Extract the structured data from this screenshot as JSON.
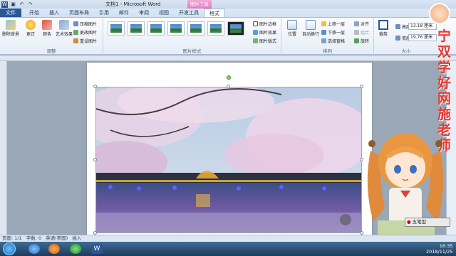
{
  "window": {
    "title": "文档1 - Microsoft Word",
    "context_tool": "图片工具"
  },
  "tabs": [
    "文件",
    "开始",
    "插入",
    "页面布局",
    "引用",
    "邮件",
    "审阅",
    "视图",
    "开发工具",
    "格式"
  ],
  "ribbon": {
    "adjust": {
      "label": "调整",
      "remove_bg": "删除背景",
      "corrections": "更正",
      "color": "颜色",
      "artistic": "艺术效果",
      "compress": "压缩图片",
      "change": "更改图片",
      "reset": "重设图片"
    },
    "styles": {
      "label": "图片样式",
      "border": "图片边框",
      "effects": "图片效果",
      "layout": "图片版式"
    },
    "arrange": {
      "label": "排列",
      "position": "位置",
      "wrap": "自动换行",
      "forward": "上移一层",
      "backward": "下移一层",
      "selection_pane": "选择窗格",
      "align": "对齐",
      "group": "组合",
      "rotate": "旋转"
    },
    "size": {
      "label": "大小",
      "crop": "裁剪",
      "height_label": "高度:",
      "height": "13.18 厘米",
      "width_label": "宽度:",
      "width": "19.76 厘米"
    }
  },
  "status": {
    "page": "页面: 1/1",
    "words": "字数: 0",
    "lang": "英语(美国)",
    "mode": "插入"
  },
  "watermark": "宁双学好网施老师",
  "ime": "五笔型",
  "clock": {
    "time": "16:35",
    "date": "2018/11/25"
  }
}
